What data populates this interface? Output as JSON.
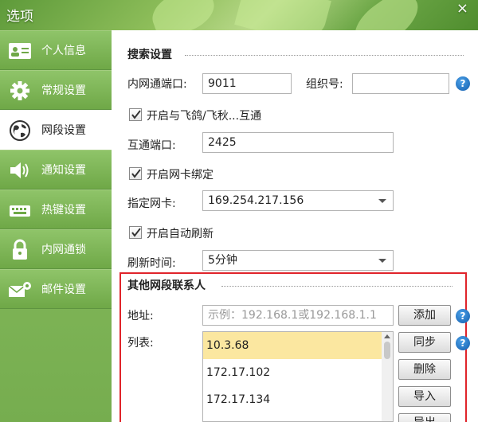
{
  "window": {
    "title": "选项",
    "close_glyph": "×"
  },
  "sidebar": {
    "items": [
      {
        "label": "个人信息",
        "icon": "id-card-icon",
        "active": false
      },
      {
        "label": "常规设置",
        "icon": "gear-icon",
        "active": false
      },
      {
        "label": "网段设置",
        "icon": "globe-icon",
        "active": true
      },
      {
        "label": "通知设置",
        "icon": "speaker-icon",
        "active": false
      },
      {
        "label": "热键设置",
        "icon": "keyboard-icon",
        "active": false
      },
      {
        "label": "内网通锁",
        "icon": "lock-icon",
        "active": false
      },
      {
        "label": "邮件设置",
        "icon": "mail-gear-icon",
        "active": false
      }
    ]
  },
  "search": {
    "section_title": "搜索设置",
    "port_label": "内网通端口:",
    "port_value": "9011",
    "org_label": "组织号:",
    "org_value": "",
    "interop_checkbox": "开启与飞鸽/飞秋...互通",
    "interop_checked": true,
    "interop_port_label": "互通端口:",
    "interop_port_value": "2425",
    "nic_bind_checkbox": "开启网卡绑定",
    "nic_bind_checked": true,
    "nic_label": "指定网卡:",
    "nic_value": "169.254.217.156",
    "auto_refresh_checkbox": "开启自动刷新",
    "auto_refresh_checked": true,
    "refresh_label": "刷新时间:",
    "refresh_value": "5分钟"
  },
  "other_segment": {
    "section_title": "其他网段联系人",
    "address_label": "地址:",
    "address_placeholder": "示例：192.168.1或192.168.1.1",
    "add_button": "添加",
    "list_label": "列表:",
    "list_items": [
      "10.3.68",
      "172.17.102",
      "172.17.134"
    ],
    "selected_index": 0,
    "sync_button": "同步",
    "delete_button": "删除",
    "import_button": "导入",
    "export_button": "导出"
  },
  "colors": {
    "accent_green": "#7fb55a",
    "highlight_box": "#e0242a",
    "selected_row": "#fbe7a0",
    "help_blue": "#1e6fc2"
  }
}
